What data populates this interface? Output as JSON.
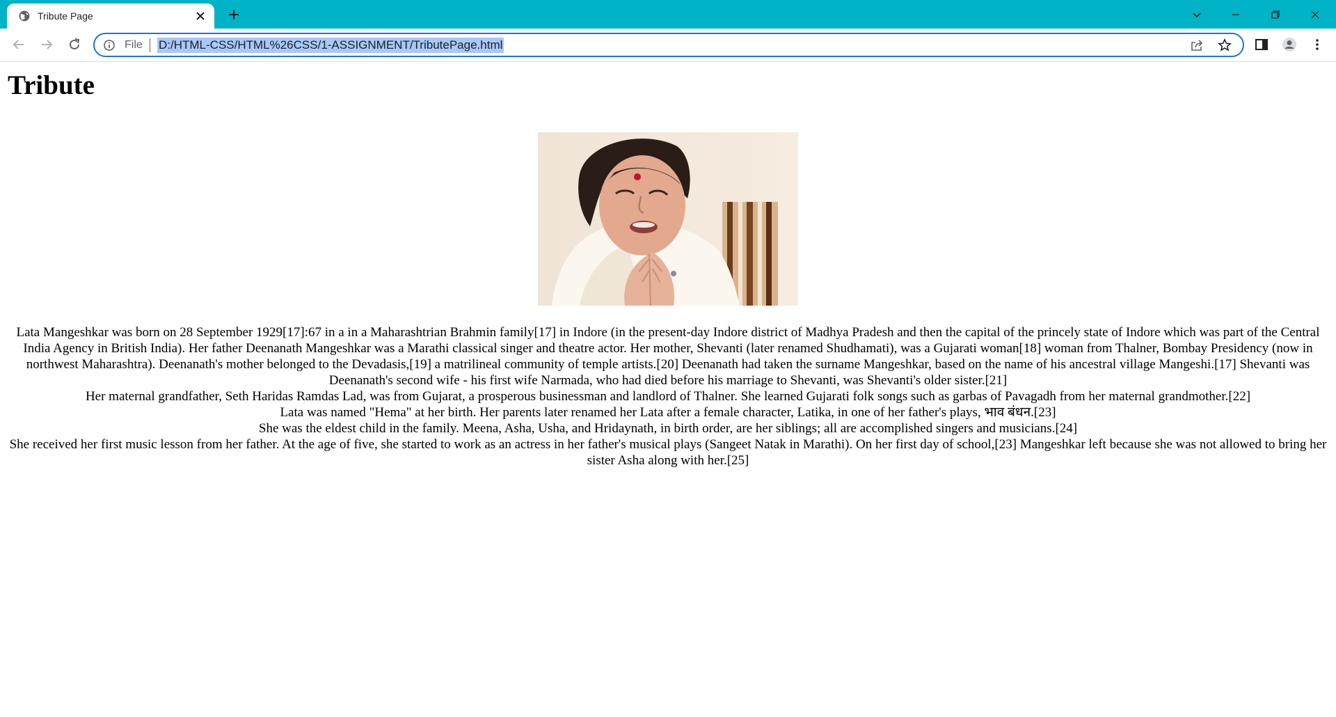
{
  "browser": {
    "tab_title": "Tribute Page",
    "omnibox": {
      "scheme_label": "File",
      "url": "D:/HTML-CSS/HTML%26CSS/1-ASSIGNMENT/TributePage.html"
    },
    "colors": {
      "tabstrip": "#00b3c6",
      "url_highlight": "#a8c7fa",
      "focus_ring": "#1a73e8"
    }
  },
  "page": {
    "heading": "Tribute",
    "paragraphs": [
      "Lata Mangeshkar was born on 28 September 1929[17]:67 in a in a Maharashtrian Brahmin family[17] in Indore (in the present-day Indore district of Madhya Pradesh and then the capital of the princely state of Indore which was part of the Central India Agency in British India). Her father Deenanath Mangeshkar was a Marathi classical singer and theatre actor. Her mother, Shevanti (later renamed Shudhamati), was a Gujarati woman[18] woman from Thalner, Bombay Presidency (now in northwest Maharashtra). Deenanath's mother belonged to the Devadasis,[19] a matrilineal community of temple artists.[20] Deenanath had taken the surname Mangeshkar, based on the name of his ancestral village Mangeshi.[17] Shevanti was Deenanath's second wife - his first wife Narmada, who had died before his marriage to Shevanti, was Shevanti's older sister.[21]",
      "Her maternal grandfather, Seth Haridas Ramdas Lad, was from Gujarat, a prosperous businessman and landlord of Thalner. She learned Gujarati folk songs such as garbas of Pavagadh from her maternal grandmother.[22]",
      "Lata was named \"Hema\" at her birth. Her parents later renamed her Lata after a female character, Latika, in one of her father's plays, भाव बंधन.[23]",
      "She was the eldest child in the family. Meena, Asha, Usha, and Hridaynath, in birth order, are her siblings; all are accomplished singers and musicians.[24]",
      "She received her first music lesson from her father. At the age of five, she started to work as an actress in her father's musical plays (Sangeet Natak in Marathi). On her first day of school,[23] Mangeshkar left because she was not allowed to bring her sister Asha along with her.[25]"
    ]
  }
}
